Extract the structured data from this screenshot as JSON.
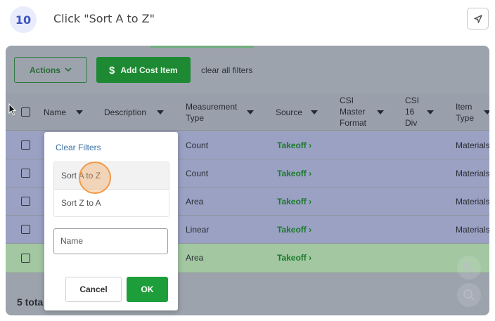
{
  "header": {
    "step_number": "10",
    "instruction": "Click \"Sort A to Z\""
  },
  "toolbar": {
    "actions_label": "Actions",
    "add_cost_item_label": "Add Cost Item",
    "clear_all_filters_label": "clear all filters"
  },
  "table": {
    "columns": [
      {
        "label": "Name"
      },
      {
        "label": "Description"
      },
      {
        "label": "Measurement\nType"
      },
      {
        "label": "Source"
      },
      {
        "label": "CSI\nMaster\nFormat"
      },
      {
        "label": "CSI\n16\nDiv"
      },
      {
        "label": "Item\nType"
      }
    ],
    "rows": [
      {
        "measurement_type": "Count",
        "source": "Takeoff ›",
        "item_type": "Materials"
      },
      {
        "measurement_type": "Count",
        "source": "Takeoff ›",
        "item_type": "Materials"
      },
      {
        "measurement_type": "Area",
        "source": "Takeoff ›",
        "item_type": "Materials"
      },
      {
        "measurement_type": "Linear",
        "source": "Takeoff ›",
        "item_type": "Materials"
      },
      {
        "measurement_type": "Area",
        "source": "Takeoff ›",
        "item_type": ""
      }
    ],
    "footer_text": "5 tota"
  },
  "filter_popup": {
    "title": "Clear Filters",
    "sort_options": [
      "Sort A to Z",
      "Sort Z to A"
    ],
    "name_input_placeholder": "Name",
    "cancel_label": "Cancel",
    "ok_label": "OK"
  },
  "colors": {
    "accent_green": "#1d8a33",
    "step_badge_blue": "#3f55c2",
    "click_highlight": "#f39a48"
  },
  "icons": {
    "nav": "navigation-arrow-icon",
    "dollar": "dollar-icon",
    "zoom_in": "zoom-in-icon",
    "zoom_out": "zoom-out-icon",
    "cursor": "mouse-cursor-icon"
  }
}
